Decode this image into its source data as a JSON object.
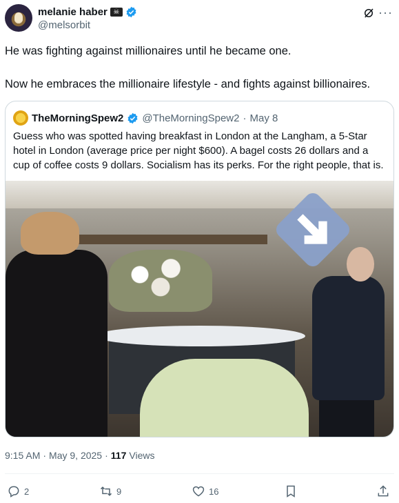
{
  "author": {
    "display_name": "melanie haber",
    "flag_icon": "pirate-flag",
    "handle": "@melsorbit"
  },
  "tweet": {
    "text": "He was fighting against millionaires until he became one.\n\nNow he embraces the millionaire lifestyle - and fights against billionaires."
  },
  "quote": {
    "display_name": "TheMorningSpew2",
    "handle": "@TheMorningSpew2",
    "separator": "·",
    "date": "May 8",
    "text": "Guess who was spotted having breakfast in London at the Langham, a 5-Star hotel in London (average price per night $600). A bagel costs 26 dollars and a cup of coffee costs 9 dollars. Socialism has its perks. For the right people, that is."
  },
  "meta": {
    "time": "9:15 AM",
    "separator": "·",
    "date": "May 9, 2025",
    "separator2": "·",
    "views_count": "117",
    "views_label": "Views"
  },
  "actions": {
    "replies": "2",
    "reposts": "9",
    "likes": "16"
  },
  "colors": {
    "verified": "#1d9bf0",
    "secondary_text": "#536471",
    "border": "#cfd9de"
  }
}
